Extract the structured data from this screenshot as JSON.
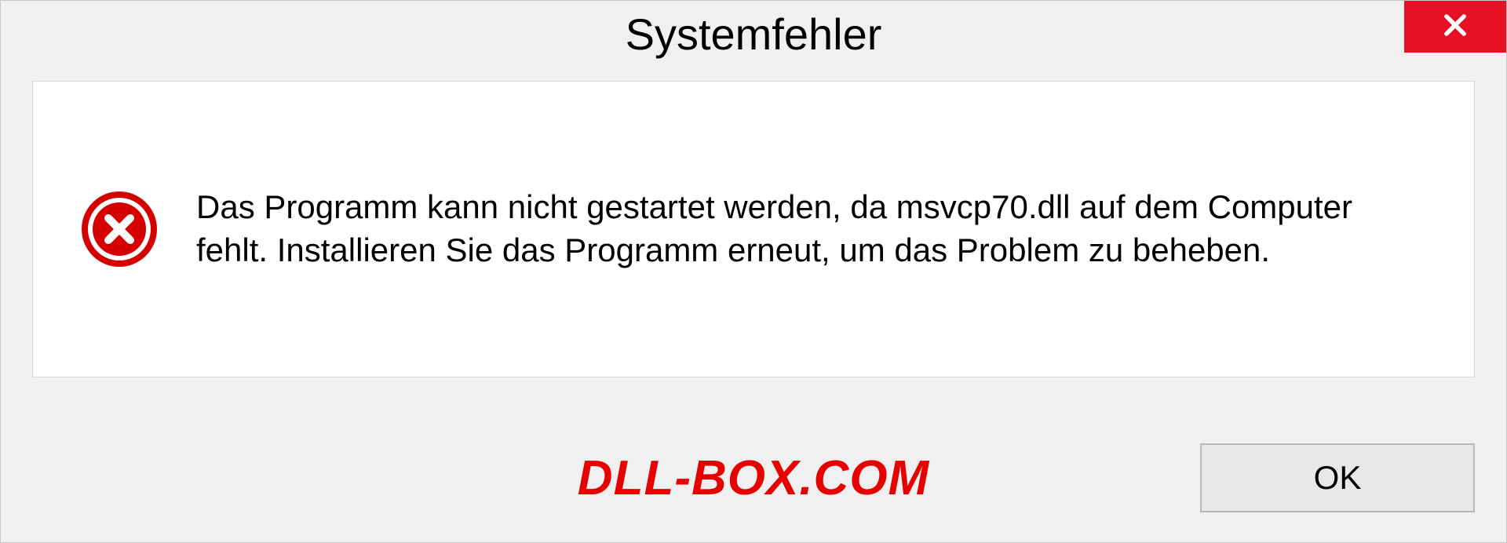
{
  "dialog": {
    "title": "Systemfehler",
    "message": "Das Programm kann nicht gestartet werden, da msvcp70.dll auf dem Computer fehlt. Installieren Sie das Programm erneut, um das Problem zu beheben.",
    "ok_label": "OK"
  },
  "watermark": "DLL-BOX.COM"
}
